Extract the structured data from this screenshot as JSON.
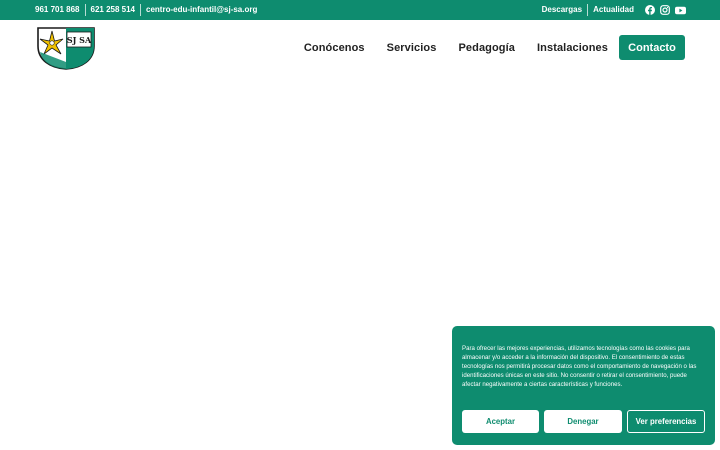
{
  "colors": {
    "brand": "#0e8c6f",
    "text_dark": "#222222",
    "background": "#ffffff"
  },
  "topbar": {
    "phone_1": "961 701 868",
    "phone_2": "621 258 514",
    "email": "centro-edu-infantil@sj-sa.org",
    "links": [
      "Descargas",
      "Actualidad"
    ],
    "social_icons": [
      "facebook-icon",
      "instagram-icon",
      "youtube-icon"
    ]
  },
  "header": {
    "logo_icon": "school-shield-logo",
    "logo_text": "SJ SA",
    "nav": [
      "Conócenos",
      "Servicios",
      "Pedagogía",
      "Instalaciones"
    ],
    "contact_label": "Contacto"
  },
  "cookie_banner": {
    "text": "Para ofrecer las mejores experiencias, utilizamos tecnologías como las cookies para almacenar y/o acceder a la información del dispositivo. El consentimiento de estas tecnologías nos permitirá procesar datos como el comportamiento de navegación o las identificaciones únicas en este sitio. No consentir o retirar el consentimiento, puede afectar negativamente a ciertas características y funciones.",
    "accept_label": "Aceptar",
    "deny_label": "Denegar",
    "preferences_label": "Ver preferencias"
  }
}
